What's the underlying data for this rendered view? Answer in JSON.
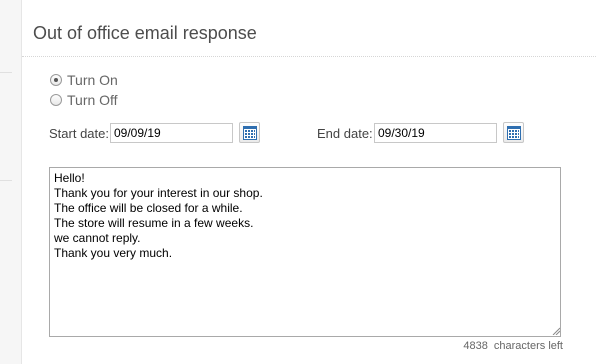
{
  "title": "Out of office email response",
  "options": [
    {
      "label": "Turn On",
      "selected": true
    },
    {
      "label": "Turn Off",
      "selected": false
    }
  ],
  "start": {
    "label": "Start date:",
    "value": "09/09/19"
  },
  "end": {
    "label": "End date:",
    "value": "09/30/19"
  },
  "message": "Hello!\nThank you for your interest in our shop.\nThe office will be closed for a while.\nThe store will resume in a few weeks.\nwe cannot reply.\nThank you very much.",
  "counter": {
    "count": "4838",
    "label": "characters left"
  },
  "icons": {
    "calendar": "calendar-icon",
    "accent": "#2f6fb0"
  }
}
